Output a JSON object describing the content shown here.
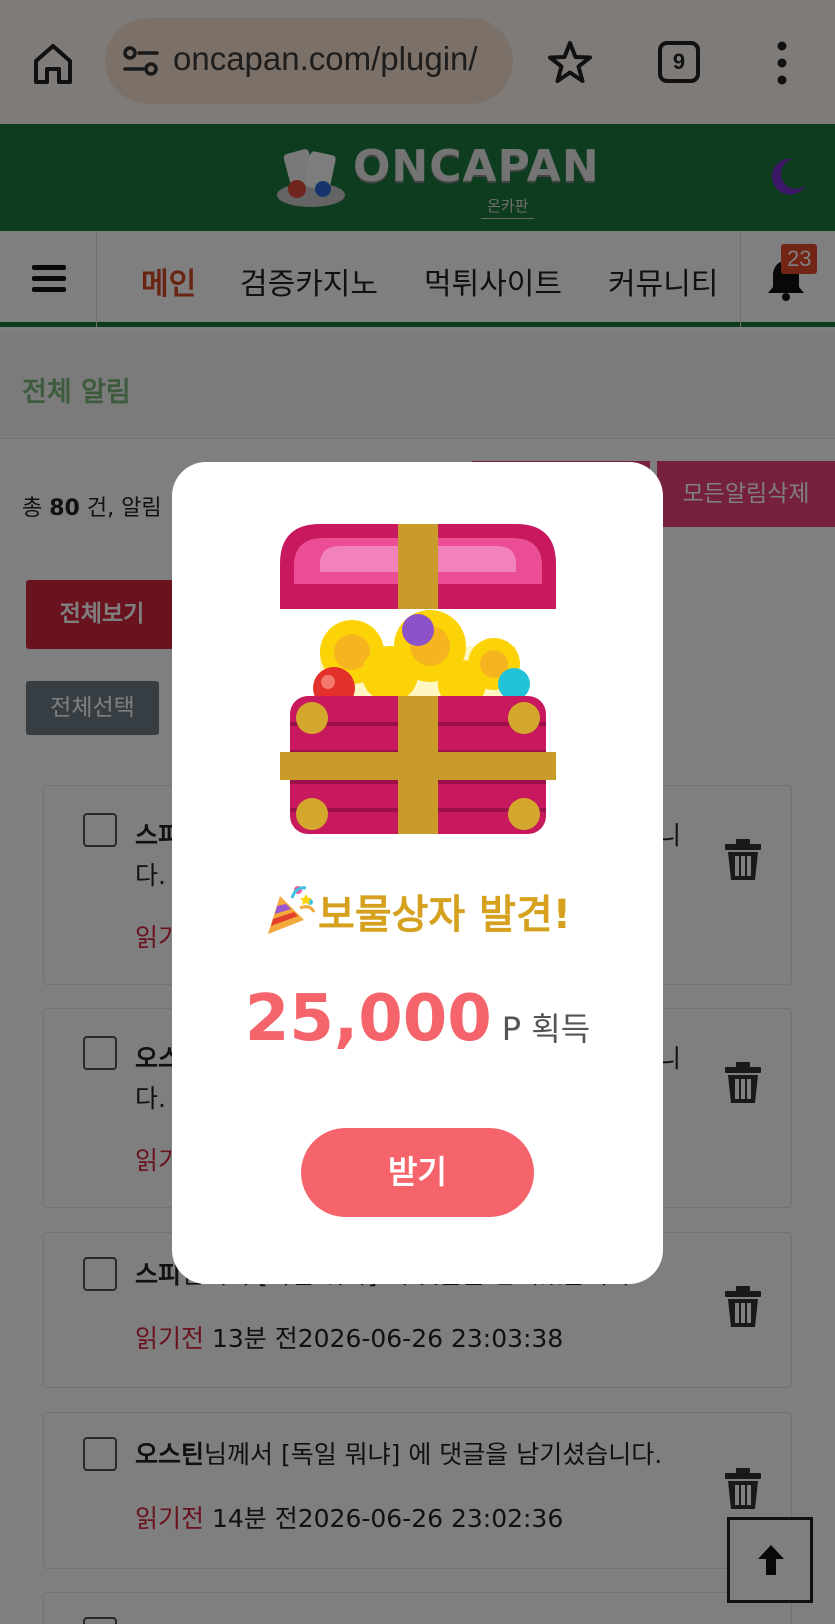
{
  "browser": {
    "url": "oncapan.com/plugin/",
    "tab_count": "9"
  },
  "site": {
    "logo_text": "ONCAPAN",
    "logo_sub": "온카판"
  },
  "nav": {
    "items": [
      "메인",
      "검증카지노",
      "먹튀사이트",
      "커뮤니티"
    ],
    "notification_badge": "23"
  },
  "page": {
    "title": "전체 알림",
    "total_prefix": "총 ",
    "total_count": "80",
    "total_suffix": " 건, 알림",
    "delete_all_label": "모든알림삭제",
    "view_all_label": "전체보기",
    "select_all_label": "전체선택"
  },
  "notifications": [
    {
      "user": "스피",
      "text_tail": "니",
      "line2": "다.",
      "status": "읽기"
    },
    {
      "user": "오스",
      "text_tail": "니",
      "line2": "다.",
      "status": "읽기"
    },
    {
      "user": "스피",
      "message": "님께서 [독일 뭐냐] 에 댓글을 남기셨습니다.",
      "status": "읽기전",
      "time": " 13분 전2026-06-26 23:03:38"
    },
    {
      "user": "오스틴",
      "message": "님께서 [독일 뭐냐] 에 댓글을 남기셨습니다.",
      "status": "읽기전",
      "time": " 14분 전2026-06-26 23:02:36"
    }
  ],
  "modal": {
    "title": "보물상자 발견!",
    "amount": "25,000",
    "unit": "P 획득",
    "claim_label": "받기"
  },
  "colors": {
    "header_green": "#1b7a3c",
    "nav_active": "#d34a24",
    "badge": "#e5482a",
    "pink": "#e8417d",
    "red_button": "#d3263c",
    "reward_coral": "#f4646a",
    "title_gold": "#d5a11e"
  },
  "icons": [
    "home-icon",
    "site-settings-icon",
    "star-icon",
    "tabs-icon",
    "more-vert-icon",
    "moon-icon",
    "hamburger-icon",
    "bell-icon",
    "trash-icon",
    "arrow-up-icon",
    "treasure-chest-icon",
    "party-popper-icon"
  ]
}
